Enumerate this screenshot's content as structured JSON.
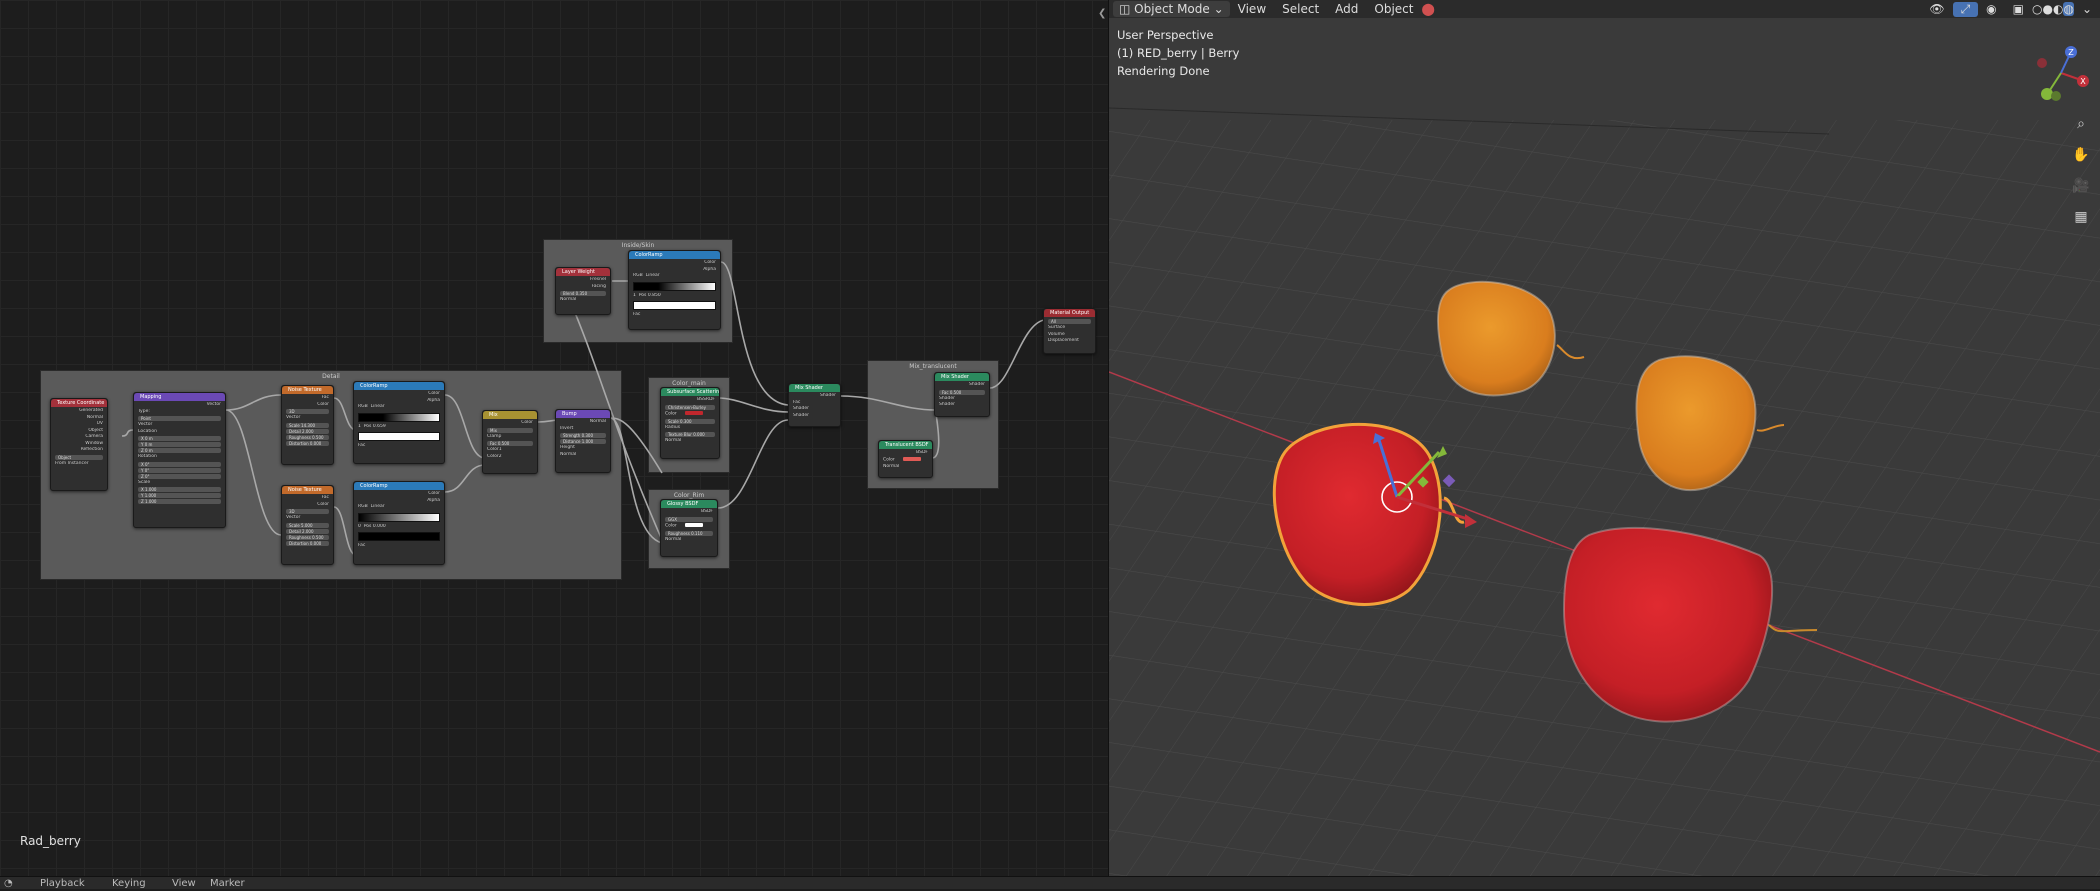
{
  "node_editor": {
    "material_name": "Rad_berry",
    "frames": {
      "detail": "Detail",
      "inside": "Inside/Skin",
      "color_main": "Color_main",
      "color_rim": "Color_Rim",
      "mix": "Mix_translucent"
    },
    "nodes": {
      "texcoord": {
        "title": "Texture Coordinate",
        "rows": [
          "Generated",
          "Normal",
          "UV",
          "Object",
          "Camera",
          "Window",
          "Reflection"
        ],
        "object_label": "Object",
        "from_instancer": "From Instancer"
      },
      "mapping": {
        "title": "Mapping",
        "out": "Vector",
        "type_label": "Type:",
        "type_value": "Point",
        "vector": "Vector",
        "location": "Location",
        "loc": [
          "X  0 m",
          "Y  0 m",
          "Z  0 m"
        ],
        "rotation": "Rotation",
        "rot": [
          "X  0°",
          "Y  0°",
          "Z  0°"
        ],
        "scale": "Scale",
        "scl": [
          "X  1.000",
          "Y  1.000",
          "Z  1.000"
        ]
      },
      "noise1": {
        "title": "Noise Texture",
        "outs": [
          "Fac",
          "Color"
        ],
        "dim": "3D",
        "vector": "Vector",
        "fields": [
          "Scale  14.300",
          "Detail  2.000",
          "Roughness  0.500",
          "Distortion  0.000"
        ]
      },
      "noise2": {
        "title": "Noise Texture",
        "outs": [
          "Fac",
          "Color"
        ],
        "dim": "3D",
        "vector": "Vector",
        "fields": [
          "Scale  5.000",
          "Detail  2.000",
          "Roughness  0.500",
          "Distortion  0.000"
        ]
      },
      "ramp1": {
        "title": "ColorRamp",
        "outs": [
          "Color",
          "Alpha"
        ],
        "mode": "RGB",
        "interp": "Linear",
        "pos": "1",
        "pos_label": "Pos",
        "pos_val": "0.659",
        "fac": "Fac"
      },
      "ramp2": {
        "title": "ColorRamp",
        "outs": [
          "Color",
          "Alpha"
        ],
        "mode": "RGB",
        "interp": "Linear",
        "pos": "0",
        "pos_label": "Pos",
        "pos_val": "0.000",
        "fac": "Fac"
      },
      "mix": {
        "title": "Mix",
        "out": "Color",
        "blend": "Mix",
        "clamp": "Clamp",
        "fac": "Fac  0.500",
        "c1": "Color1",
        "c2": "Color2"
      },
      "bump": {
        "title": "Bump",
        "out": "Normal",
        "invert": "Invert",
        "strength": "Strength  0.300",
        "distance": "Distance  1.000",
        "height": "Height",
        "normal": "Normal"
      },
      "layerweight": {
        "title": "Layer Weight",
        "outs": [
          "Fresnel",
          "Facing"
        ],
        "blend": "Blend  0.350",
        "normal": "Normal"
      },
      "ramp3": {
        "title": "ColorRamp",
        "outs": [
          "Color",
          "Alpha"
        ],
        "mode": "RGB",
        "interp": "Linear",
        "pos": "1",
        "pos_label": "Pos",
        "pos_val": "0.850",
        "fac": "Fac"
      },
      "sss": {
        "title": "Subsurface Scattering",
        "out": "BSSRDF",
        "method": "Christensen-Burley",
        "color": "Color",
        "scale": "Scale  0.300",
        "radius": "Radius",
        "texture_blur": "Texture Blur  0.000",
        "normal": "Normal"
      },
      "glossy": {
        "title": "Glossy BSDF",
        "out": "BSDF",
        "dist": "GGX",
        "color": "Color",
        "roughness": "Roughness  0.110",
        "normal": "Normal"
      },
      "mixshader1": {
        "title": "Mix Shader",
        "out": "Shader",
        "fac": "Fac",
        "s1": "Shader",
        "s2": "Shader"
      },
      "mixshader2": {
        "title": "Mix Shader",
        "out": "Shader",
        "fac": "Fac  0.500",
        "s1": "Shader",
        "s2": "Shader"
      },
      "translucent": {
        "title": "Translucent BSDF",
        "out": "BSDF",
        "color": "Color",
        "normal": "Normal"
      },
      "output": {
        "title": "Material Output",
        "target": "All",
        "rows": [
          "Surface",
          "Volume",
          "Displacement"
        ]
      }
    }
  },
  "viewport": {
    "mode": "Object Mode",
    "menu": [
      "View",
      "Select",
      "Add",
      "Object"
    ],
    "overlay": [
      "User Perspective",
      "(1) RED_berry | Berry",
      "Rendering Done"
    ],
    "gizmo_axes": [
      "X",
      "Y",
      "Z"
    ],
    "tools": [
      "zoom-icon",
      "hand-icon",
      "camera-icon",
      "grid-icon"
    ]
  },
  "status_bar": {
    "items": [
      "Playback",
      "Keying",
      "View",
      "Marker"
    ]
  },
  "colors": {
    "red_berry": "#c8232b",
    "orange_berry": "#e38a20",
    "selection": "#f2a23a",
    "x_axis": "#b23a4a"
  }
}
